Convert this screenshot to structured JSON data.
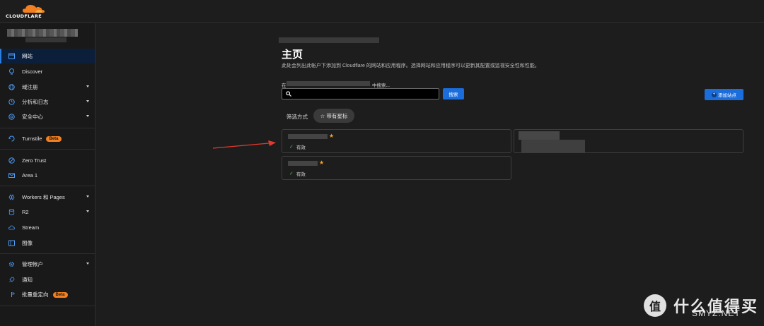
{
  "brand": {
    "name": "CLOUDFLARE",
    "accent": "#f38020",
    "primary_button": "#1b6ddc"
  },
  "sidebar": {
    "items": [
      {
        "label": "网站",
        "icon": "browser-window-icon",
        "active": true
      },
      {
        "label": "Discover",
        "icon": "lightbulb-icon"
      },
      {
        "label": "域注册",
        "icon": "globe-icon",
        "caret": true
      },
      {
        "label": "分析和日志",
        "icon": "clock-chart-icon",
        "caret": true
      },
      {
        "label": "安全中心",
        "icon": "radar-icon",
        "caret": true
      },
      {
        "label": "Turnstile",
        "icon": "turnstile-icon",
        "badge": "Beta"
      },
      {
        "label": "Zero Trust",
        "icon": "zero-trust-icon"
      },
      {
        "label": "Area 1",
        "icon": "mail-icon"
      },
      {
        "label": "Workers 和 Pages",
        "icon": "workers-icon",
        "caret": true
      },
      {
        "label": "R2",
        "icon": "database-icon",
        "caret": true
      },
      {
        "label": "Stream",
        "icon": "cloud-icon"
      },
      {
        "label": "图像",
        "icon": "image-icon"
      },
      {
        "label": "管理帐户",
        "icon": "gear-icon",
        "caret": true
      },
      {
        "label": "通知",
        "icon": "rocket-icon"
      },
      {
        "label": "批量重定向",
        "icon": "redirect-icon",
        "badge": "Beta"
      }
    ]
  },
  "main": {
    "title": "主页",
    "description": "此处会列出此帐户下添加到 Cloudflare 的网站和应用程序。选择网站和应用程序可以更新其配置或监视安全性和性能。",
    "search_prompt_start": "在",
    "search_prompt_end": "中搜索...",
    "search_button": "搜索",
    "add_site_button": "添加站点",
    "filter_label": "筛选方式",
    "filter_chip": "☆ 带有星标",
    "cards": [
      {
        "status": "有效",
        "starred": true
      },
      {
        "status": "",
        "starred": false
      },
      {
        "status": "有效",
        "starred": true
      }
    ]
  },
  "watermark": {
    "logo": "值",
    "text": "什么值得买",
    "sub": "SMYZ.NET"
  }
}
